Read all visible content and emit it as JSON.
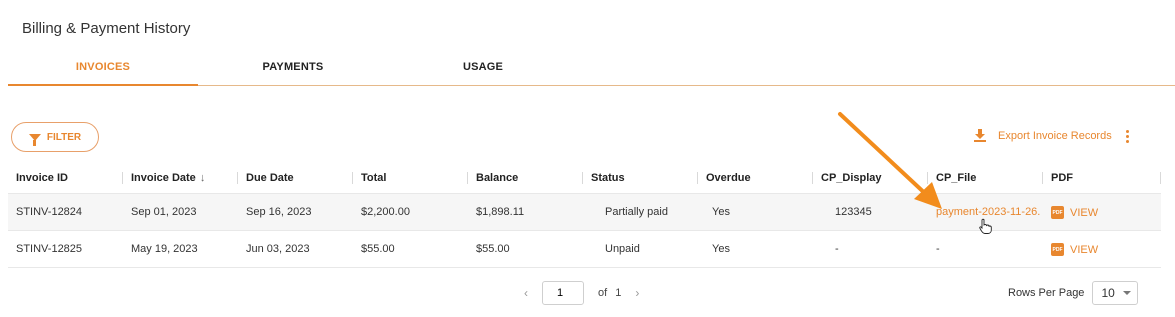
{
  "page": {
    "title": "Billing & Payment History"
  },
  "tabs": [
    {
      "label": "INVOICES",
      "active": true
    },
    {
      "label": "PAYMENTS",
      "active": false
    },
    {
      "label": "USAGE",
      "active": false
    }
  ],
  "toolbar": {
    "filter_label": "FILTER",
    "export_label": "Export Invoice Records"
  },
  "table": {
    "columns": [
      "Invoice ID",
      "Invoice Date",
      "Due Date",
      "Total",
      "Balance",
      "Status",
      "Overdue",
      "CP_Display",
      "CP_File",
      "PDF"
    ],
    "sort": {
      "column": "Invoice Date",
      "direction": "desc",
      "indicator": "↓"
    },
    "rows": [
      {
        "invoice_id": "STINV-12824",
        "invoice_date": "Sep 01, 2023",
        "due_date": "Sep 16, 2023",
        "total": "$2,200.00",
        "balance": "$1,898.11",
        "status": "Partially paid",
        "overdue": "Yes",
        "cp_display": "123345",
        "cp_file": "payment-2023-11-26.",
        "pdf": "VIEW"
      },
      {
        "invoice_id": "STINV-12825",
        "invoice_date": "May 19, 2023",
        "due_date": "Jun 03, 2023",
        "total": "$55.00",
        "balance": "$55.00",
        "status": "Unpaid",
        "overdue": "Yes",
        "cp_display": "-",
        "cp_file": "-",
        "pdf": "VIEW"
      }
    ]
  },
  "pagination": {
    "current_page": "1",
    "of_label": "of",
    "total_pages": "1",
    "rows_per_page_label": "Rows Per Page",
    "rows_per_page": "10"
  },
  "colors": {
    "accent": "#e8872f",
    "arrow": "#f28c1c"
  },
  "icons": [
    "funnel-icon",
    "download-icon",
    "kebab-menu-icon",
    "sort-down-icon",
    "pdf-icon",
    "chevron-left-icon",
    "chevron-right-icon",
    "caret-down-icon",
    "cursor-hand-icon"
  ]
}
